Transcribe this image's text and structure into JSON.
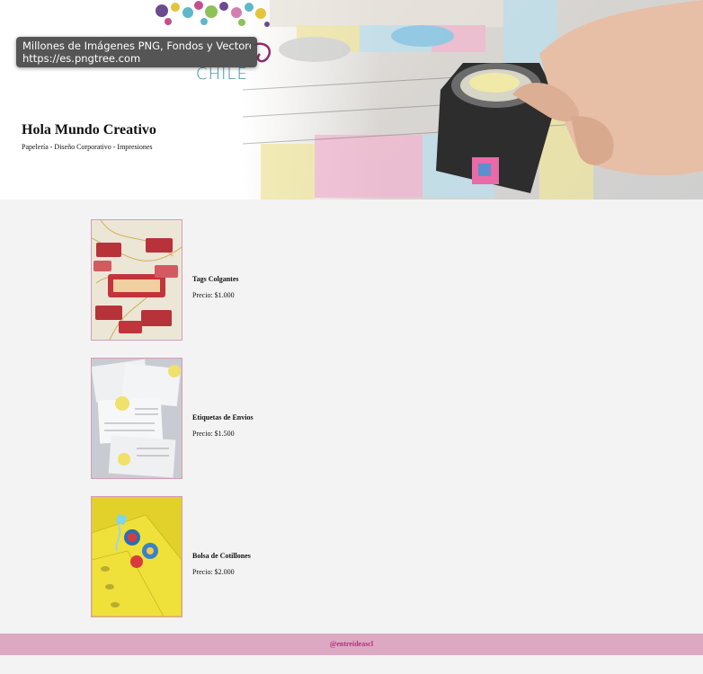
{
  "tooltip": {
    "line1": "Millones de Imágenes PNG, Fondos y Vectores...",
    "line2": "https://es.pngtree.com"
  },
  "logo": {
    "city": "CHILE"
  },
  "hero": {
    "title": "Hola Mundo Creativo",
    "subtitle": "Papelería - Diseño Corporativo - Impresiones"
  },
  "products": [
    {
      "name": "Tags Colgantes",
      "price": "Precio: $1.000"
    },
    {
      "name": "Etiquetas de Envios",
      "price": "Precio: $1.500"
    },
    {
      "name": "Bolsa de Cotillones",
      "price": "Precio: $2.000"
    }
  ],
  "footer": {
    "handle": "@entreideascl"
  },
  "colors": {
    "footer_bg": "#dca8c2",
    "footer_text": "#b0327a",
    "image_border": "#d99ab8",
    "background": "#f3f3f3"
  }
}
